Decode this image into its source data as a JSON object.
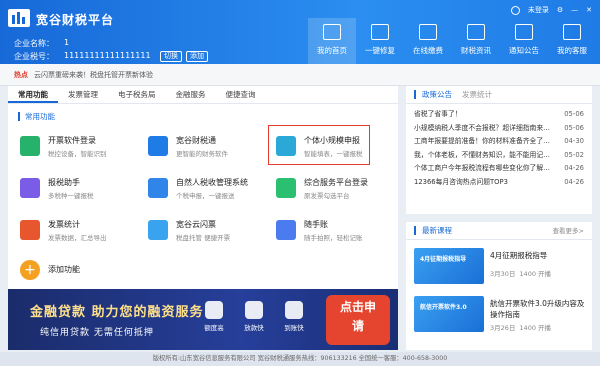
{
  "app": {
    "title": "宽谷财税平台"
  },
  "company": {
    "name_label": "企业名称：",
    "name_value": "1",
    "tax_label": "企业税号：",
    "tax_value": "11111111111111111",
    "switch_btn": "切换",
    "add_btn": "添加"
  },
  "topbar": {
    "login": "未登录"
  },
  "nav": [
    {
      "label": "我的首页",
      "icon": "home-icon"
    },
    {
      "label": "一键修复",
      "icon": "wrench-icon"
    },
    {
      "label": "在线缴费",
      "icon": "payment-icon"
    },
    {
      "label": "财税资讯",
      "icon": "news-icon"
    },
    {
      "label": "通知公告",
      "icon": "megaphone-icon"
    },
    {
      "label": "我的客服",
      "icon": "headset-icon"
    }
  ],
  "notice": {
    "tag": "热点",
    "text": "云闪票重磅来袭！税盘托管开票新体验"
  },
  "tabs": [
    "常用功能",
    "发票管理",
    "电子税务局",
    "金融服务",
    "便捷查询"
  ],
  "section_title": "常用功能",
  "tiles": [
    {
      "title": "开票软件登录",
      "sub": "税控设备，智能识别",
      "color": "#26b26a"
    },
    {
      "title": "宽谷财税通",
      "sub": "更智能的财务软件",
      "color": "#1f7be6"
    },
    {
      "title": "个体小规模申报",
      "sub": "智能填表，一键报税",
      "color": "#2aa8d8"
    },
    {
      "title": "报税助手",
      "sub": "多税种一键报税",
      "color": "#7b5ce6"
    },
    {
      "title": "自然人税收管理系统",
      "sub": "个税申报，一键报送",
      "color": "#2f86e8"
    },
    {
      "title": "综合服务平台登录",
      "sub": "原发票勾选平台",
      "color": "#2bbf72"
    },
    {
      "title": "发票统计",
      "sub": "发票数据，汇总导出",
      "color": "#e8562e"
    },
    {
      "title": "宽谷云闪票",
      "sub": "税盘托管 便捷开票",
      "color": "#39a3ef"
    },
    {
      "title": "随手账",
      "sub": "随手拍照，轻松记账",
      "color": "#4a7cf0"
    },
    {
      "title": "添加功能",
      "sub": "",
      "color": "#f4a020"
    }
  ],
  "banner": {
    "headline": "金融贷款 助力您的融资服务",
    "sub": "纯信用贷款 无需任何抵押",
    "icons": [
      "额度高",
      "放款快",
      "到账快"
    ],
    "cta": "点击申请"
  },
  "policy": {
    "title": "政策公告",
    "sub": "发票统计",
    "items": [
      {
        "t": "省税了省事了！",
        "d": "05-06"
      },
      {
        "t": "小规模纳税人季度不会报税？超详细指南来喽！",
        "d": "05-06"
      },
      {
        "t": "工商年报要提前准备！你的材料准备齐全了吗？",
        "d": "04-30"
      },
      {
        "t": "我，个体老板，不懂财务知识，能不能用记账软件？",
        "d": "05-02"
      },
      {
        "t": "个体工商户今年报税流程有哪些变化你了解吗？征税事项",
        "d": "04-26"
      },
      {
        "t": "12366每月咨询热点问题TOP3",
        "d": "04-26"
      }
    ]
  },
  "courses": {
    "title": "最新课程",
    "more": "查看更多>",
    "items": [
      {
        "title": "4月征期报税指导",
        "date": "3月30日",
        "status": "1400 开播",
        "thumb": "4月征期报税指导"
      },
      {
        "title": "航信开票软件3.0升级内容及操作指南",
        "date": "3月26日",
        "status": "1400 开播",
        "thumb": "航信开票软件3.0"
      }
    ]
  },
  "footer": {
    "text": "版权所有:山东宽谷信息服务有限公司      宽谷财税通服务热线：906133216      全国统一客服：400-658-3000"
  }
}
